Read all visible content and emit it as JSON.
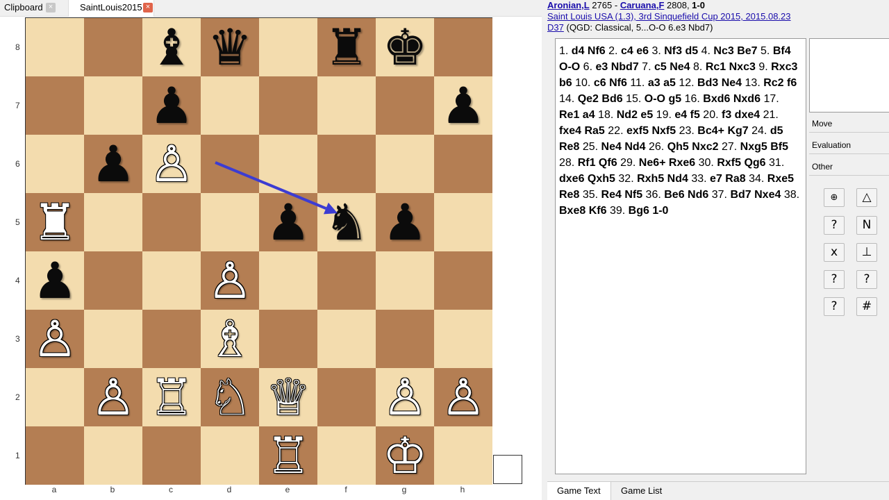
{
  "tabs": [
    {
      "label": "Clipboard",
      "close": "×"
    },
    {
      "label": "SaintLouis2015",
      "close": "×"
    }
  ],
  "header": {
    "white_name": "Aronian,L",
    "white_elo": "2765",
    "sep": "-",
    "black_name": "Caruana,F",
    "black_elo": "2808",
    "result": "1-0",
    "event": "Saint Louis USA (1.3), 3rd Sinquefield Cup 2015, 2015.08.23",
    "eco": "D37",
    "opening": "(QGD: Classical, 5...O-O 6.e3 Nbd7)"
  },
  "board": {
    "files": [
      "a",
      "b",
      "c",
      "d",
      "e",
      "f",
      "g",
      "h"
    ],
    "ranks": [
      "8",
      "7",
      "6",
      "5",
      "4",
      "3",
      "2",
      "1"
    ],
    "colors": {
      "light": "#f3dcae",
      "dark": "#b47e53",
      "arrow": "#3c3cd2"
    },
    "pieces": [
      {
        "square": "c8",
        "glyph": "♝",
        "color": "black",
        "name": "black-bishop"
      },
      {
        "square": "d8",
        "glyph": "♛",
        "color": "black",
        "name": "black-queen"
      },
      {
        "square": "f8",
        "glyph": "♜",
        "color": "black",
        "name": "black-rook"
      },
      {
        "square": "g8",
        "glyph": "♚",
        "color": "black",
        "name": "black-king"
      },
      {
        "square": "c7",
        "glyph": "♟",
        "color": "black",
        "name": "black-pawn"
      },
      {
        "square": "h7",
        "glyph": "♟",
        "color": "black",
        "name": "black-pawn"
      },
      {
        "square": "b6",
        "glyph": "♟",
        "color": "black",
        "name": "black-pawn"
      },
      {
        "square": "c6",
        "glyph": "♙",
        "color": "white",
        "name": "white-pawn"
      },
      {
        "square": "a5",
        "glyph": "♜",
        "color": "white",
        "name": "white-rook"
      },
      {
        "square": "e5",
        "glyph": "♟",
        "color": "black",
        "name": "black-pawn"
      },
      {
        "square": "f5",
        "glyph": "♞",
        "color": "black",
        "name": "black-knight"
      },
      {
        "square": "g5",
        "glyph": "♟",
        "color": "black",
        "name": "black-pawn"
      },
      {
        "square": "a4",
        "glyph": "♟",
        "color": "black",
        "name": "black-pawn"
      },
      {
        "square": "d4",
        "glyph": "♙",
        "color": "white",
        "name": "white-pawn"
      },
      {
        "square": "a3",
        "glyph": "♙",
        "color": "white",
        "name": "white-pawn"
      },
      {
        "square": "d3",
        "glyph": "♗",
        "color": "white",
        "name": "white-bishop"
      },
      {
        "square": "b2",
        "glyph": "♙",
        "color": "white",
        "name": "white-pawn"
      },
      {
        "square": "c2",
        "glyph": "♖",
        "color": "white",
        "name": "white-rook"
      },
      {
        "square": "d2",
        "glyph": "♘",
        "color": "white",
        "name": "white-knight"
      },
      {
        "square": "e2",
        "glyph": "♕",
        "color": "white",
        "name": "white-queen"
      },
      {
        "square": "g2",
        "glyph": "♙",
        "color": "white",
        "name": "white-pawn"
      },
      {
        "square": "h2",
        "glyph": "♙",
        "color": "white",
        "name": "white-pawn"
      },
      {
        "square": "e1",
        "glyph": "♖",
        "color": "white",
        "name": "white-rook"
      },
      {
        "square": "g1",
        "glyph": "♔",
        "color": "white",
        "name": "white-king"
      }
    ],
    "arrow": {
      "from": "d6",
      "to": "f5"
    }
  },
  "game_text": [
    [
      "1.",
      "d4 Nf6"
    ],
    [
      "2.",
      "c4 e6"
    ],
    [
      "3.",
      "Nf3 d5"
    ],
    [
      "4.",
      "Nc3 Be7"
    ],
    [
      "5.",
      "Bf4 O-O"
    ],
    [
      "6.",
      "e3 Nbd7"
    ],
    [
      "7.",
      "c5 Ne4"
    ],
    [
      "8.",
      "Rc1 Nxc3"
    ],
    [
      "9.",
      "Rxc3 b6"
    ],
    [
      "10.",
      "c6 Nf6"
    ],
    [
      "11.",
      "a3 a5"
    ],
    [
      "12.",
      "Bd3 Ne4"
    ],
    [
      "13.",
      "Rc2 f6"
    ],
    [
      "14.",
      "Qe2 Bd6"
    ],
    [
      "15.",
      "O-O g5"
    ],
    [
      "16.",
      "Bxd6 Nxd6"
    ],
    [
      "17.",
      "Re1 a4"
    ],
    [
      "18.",
      "Nd2 e5"
    ],
    [
      "19.",
      "e4 f5"
    ],
    [
      "20.",
      "f3 dxe4"
    ],
    [
      "21.",
      "fxe4 Ra5"
    ],
    [
      "22.",
      "exf5 Nxf5"
    ],
    [
      "23.",
      "Bc4+ Kg7"
    ],
    [
      "24.",
      "d5 Re8"
    ],
    [
      "25.",
      "Ne4 Nd4"
    ],
    [
      "26.",
      "Qh5 Nxc2"
    ],
    [
      "27.",
      "Nxg5 Bf5"
    ],
    [
      "28.",
      "Rf1 Qf6"
    ],
    [
      "29.",
      "Ne6+ Rxe6"
    ],
    [
      "30.",
      "Rxf5 Qg6"
    ],
    [
      "31.",
      "dxe6 Qxh5"
    ],
    [
      "32.",
      "Rxh5 Nd4"
    ],
    [
      "33.",
      "e7 Ra8"
    ],
    [
      "34.",
      "Rxe5 Re8"
    ],
    [
      "35.",
      "Re4 Nf5"
    ],
    [
      "36.",
      "Be6 Nd6"
    ],
    [
      "37.",
      "Bd7 Nxe4"
    ],
    [
      "38.",
      "Bxe8 Kf6"
    ],
    [
      "39.",
      "Bg6 1-0"
    ]
  ],
  "side_panel": {
    "move_label": "Move",
    "evaluation_label": "Evaluation",
    "other_label": "Other",
    "buttons": [
      {
        "glyph": "⊕",
        "name": "with-idea-button"
      },
      {
        "glyph": "△",
        "name": "with-attack-button"
      },
      {
        "glyph": "?",
        "name": "symbol-q1-button"
      },
      {
        "glyph": "N",
        "name": "novelty-button"
      },
      {
        "glyph": "x",
        "name": "symbol-x-button"
      },
      {
        "glyph": "⊥",
        "name": "symbol-perp-button"
      },
      {
        "glyph": "?",
        "name": "symbol-q2-button"
      },
      {
        "glyph": "?",
        "name": "symbol-q3-button"
      },
      {
        "glyph": "?",
        "name": "symbol-q4-button"
      },
      {
        "glyph": "#",
        "name": "mate-button"
      }
    ]
  },
  "bottom_tabs": [
    "Game Text",
    "Game List"
  ]
}
